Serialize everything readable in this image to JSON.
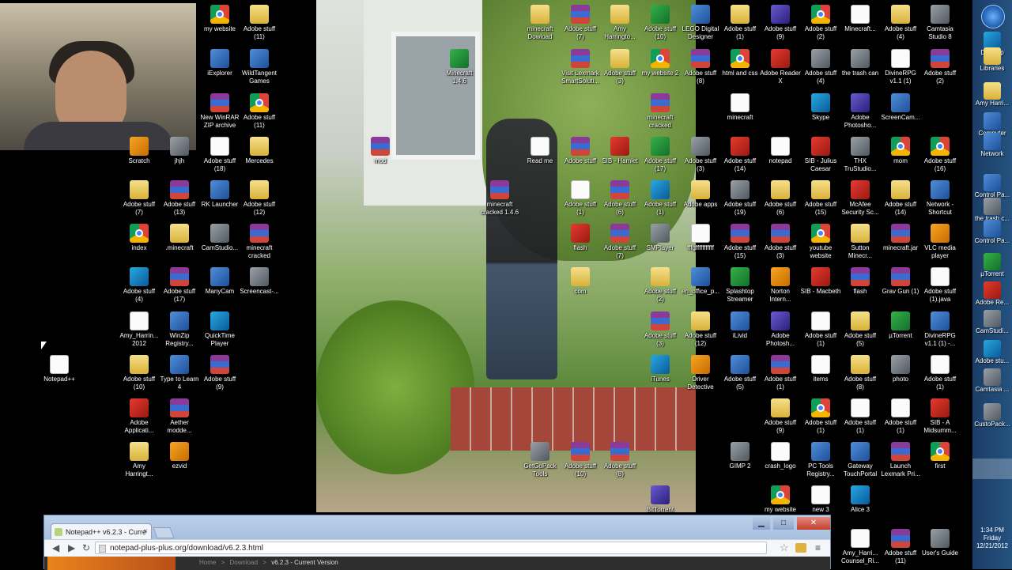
{
  "desktop": {
    "icons_left": [
      {
        "label": "my website",
        "type": "chrome"
      },
      {
        "label": "Adobe stuff (11)",
        "type": "folder"
      },
      {
        "label": "iExplorer",
        "type": "app"
      },
      {
        "label": "WildTangent Games",
        "type": "app"
      },
      {
        "label": "New WinRAR ZIP archive",
        "type": "rar"
      },
      {
        "label": "Adobe stuff (11)",
        "type": "chrome"
      },
      {
        "label": "Scratch",
        "type": "orange"
      },
      {
        "label": "jhjh",
        "type": "gray"
      },
      {
        "label": "Adobe stuff (18)",
        "type": "doc"
      },
      {
        "label": "Mercedes",
        "type": "folder"
      },
      {
        "label": "Adobe stuff (7)",
        "type": "folder"
      },
      {
        "label": "Adobe stuff (13)",
        "type": "rar"
      },
      {
        "label": "RK Launcher",
        "type": "app"
      },
      {
        "label": "Adobe stuff (12)",
        "type": "folder"
      },
      {
        "label": "index",
        "type": "chrome"
      },
      {
        "label": ".minecraft",
        "type": "folder"
      },
      {
        "label": "CamStudio...",
        "type": "gray"
      },
      {
        "label": "minecraft cracked",
        "type": "rar"
      },
      {
        "label": "Adobe stuff (4)",
        "type": "blue"
      },
      {
        "label": "Adobe stuff (17)",
        "type": "rar"
      },
      {
        "label": "ManyCam",
        "type": "app"
      },
      {
        "label": "Screencast-...",
        "type": "gray"
      },
      {
        "label": "Amy_Harrin... 2012",
        "type": "doc"
      },
      {
        "label": "WinZip Registry...",
        "type": "app"
      },
      {
        "label": "QuickTime Player",
        "type": "blue"
      },
      {
        "label": "Notepad++",
        "type": "doc"
      },
      {
        "label": "Adobe stuff (10)",
        "type": "folder"
      },
      {
        "label": "Type to Learn 4",
        "type": "app"
      },
      {
        "label": "Adobe stuff (9)",
        "type": "rar"
      },
      {
        "label": "Adobe Applicati...",
        "type": "red"
      },
      {
        "label": "Aether modde...",
        "type": "rar"
      },
      {
        "label": "Amy Harringt...",
        "type": "folder"
      },
      {
        "label": "ezvid",
        "type": "orange"
      }
    ],
    "icons_middle": [
      {
        "label": "minecraft Dowload",
        "type": "folder"
      },
      {
        "label": "Adobe stuff (7)",
        "type": "rar"
      },
      {
        "label": "Amy Harringto...",
        "type": "folder"
      },
      {
        "label": "Adobe stuff (10)",
        "type": "green"
      },
      {
        "label": "Minecraft 1.4.6",
        "type": "green"
      },
      {
        "label": "Visit Lexmark SmartSoluti...",
        "type": "rar"
      },
      {
        "label": "Adobe stuff (3)",
        "type": "folder"
      },
      {
        "label": "my website 2",
        "type": "chrome"
      },
      {
        "label": "minecraft cracked",
        "type": "rar"
      },
      {
        "label": "mod",
        "type": "rar"
      },
      {
        "label": "Read me",
        "type": "doc"
      },
      {
        "label": "Adobe stuff",
        "type": "rar"
      },
      {
        "label": "SIB - Hamlet",
        "type": "red"
      },
      {
        "label": "Adobe stuff (17)",
        "type": "green"
      },
      {
        "label": "minecraft cracked 1.4.6",
        "type": "rar"
      },
      {
        "label": "Adobe stuff (1)",
        "type": "doc"
      },
      {
        "label": "Adobe stuff (6)",
        "type": "rar"
      },
      {
        "label": "Adobe stuff (1)",
        "type": "blue"
      },
      {
        "label": "flash",
        "type": "red"
      },
      {
        "label": "Adobe stuff (7)",
        "type": "rar"
      },
      {
        "label": "SMPlayer",
        "type": "gray"
      },
      {
        "label": "com",
        "type": "folder"
      },
      {
        "label": "Adobe stuff (2)",
        "type": "folder"
      },
      {
        "label": "Adobe stuff (3)",
        "type": "rar"
      },
      {
        "label": "iTunes",
        "type": "blue"
      },
      {
        "label": "GetGoPack Tools",
        "type": "gray"
      },
      {
        "label": "Adobe stuff (10)",
        "type": "rar"
      },
      {
        "label": "Adobe stuff (8)",
        "type": "rar"
      },
      {
        "label": "BitTorrent",
        "type": "purple"
      }
    ],
    "icons_right": [
      {
        "label": "LEGO Digital Designer",
        "type": "app"
      },
      {
        "label": "Adobe stuff (1)",
        "type": "folder"
      },
      {
        "label": "Adobe stuff (9)",
        "type": "purple"
      },
      {
        "label": "Adobe stuff (2)",
        "type": "chrome"
      },
      {
        "label": "Minecraft...",
        "type": "doc"
      },
      {
        "label": "Adobe stuff (4)",
        "type": "folder"
      },
      {
        "label": "Camtasia Studio 8",
        "type": "gray"
      },
      {
        "label": "Adobe stuff (8)",
        "type": "rar"
      },
      {
        "label": "html and css",
        "type": "chrome"
      },
      {
        "label": "Adobe Reader X",
        "type": "red"
      },
      {
        "label": "Adobe stuff (4)",
        "type": "gray"
      },
      {
        "label": "the trash can",
        "type": "gray"
      },
      {
        "label": "DivineRPG v1.1 (1)",
        "type": "doc"
      },
      {
        "label": "Adobe stuff (2)",
        "type": "rar"
      },
      {
        "label": "minecraft",
        "type": "doc"
      },
      {
        "label": "Skype",
        "type": "blue"
      },
      {
        "label": "Adobe Photosho...",
        "type": "purple"
      },
      {
        "label": "ScreenCam...",
        "type": "app"
      },
      {
        "label": "Adobe stuff (3)",
        "type": "gray"
      },
      {
        "label": "Adobe stuff (14)",
        "type": "red"
      },
      {
        "label": "notepad",
        "type": "doc"
      },
      {
        "label": "SIB - Julius Caesar",
        "type": "red"
      },
      {
        "label": "THX TruStudio...",
        "type": "gray"
      },
      {
        "label": "mom",
        "type": "chrome"
      },
      {
        "label": "Adobe stuff (16)",
        "type": "chrome"
      },
      {
        "label": "Adobe apps",
        "type": "folder"
      },
      {
        "label": "Adobe stuff (19)",
        "type": "gray"
      },
      {
        "label": "Adobe stuff (6)",
        "type": "folder"
      },
      {
        "label": "Adobe stuff (15)",
        "type": "folder"
      },
      {
        "label": "McAfee Security Sc...",
        "type": "red"
      },
      {
        "label": "Adobe stuff (14)",
        "type": "folder"
      },
      {
        "label": "Network - Shortcut",
        "type": "app"
      },
      {
        "label": "fffgfffffffffff",
        "type": "doc"
      },
      {
        "label": "Adobe stuff (15)",
        "type": "rar"
      },
      {
        "label": "Adobe stuff (3)",
        "type": "rar"
      },
      {
        "label": "youtube website",
        "type": "chrome"
      },
      {
        "label": "Sutton Minecr...",
        "type": "folder"
      },
      {
        "label": "minecraft.jar",
        "type": "rar"
      },
      {
        "label": "VLC media player",
        "type": "orange"
      },
      {
        "label": "en_office_p...",
        "type": "app"
      },
      {
        "label": "Splashtop Streamer",
        "type": "green"
      },
      {
        "label": "Norton Intern...",
        "type": "orange"
      },
      {
        "label": "SIB - Macbeth",
        "type": "red"
      },
      {
        "label": "flash",
        "type": "rar"
      },
      {
        "label": "Grav Gun (1)",
        "type": "rar"
      },
      {
        "label": "Adobe stuff (1).java",
        "type": "doc"
      },
      {
        "label": "Adobe stuff (12)",
        "type": "folder"
      },
      {
        "label": "iLivid",
        "type": "app"
      },
      {
        "label": "Adobe Photosh...",
        "type": "purple"
      },
      {
        "label": "Adobe stuff (1)",
        "type": "doc"
      },
      {
        "label": "Adobe stuff (5)",
        "type": "folder"
      },
      {
        "label": "µTorrent",
        "type": "green"
      },
      {
        "label": "DivineRPG v1.1 (1) -...",
        "type": "app"
      },
      {
        "label": "Driver Detective",
        "type": "orange"
      },
      {
        "label": "Adobe stuff (5)",
        "type": "app"
      },
      {
        "label": "Adobe stuff (1)",
        "type": "rar"
      },
      {
        "label": "items",
        "type": "doc"
      },
      {
        "label": "Adobe stuff (8)",
        "type": "folder"
      },
      {
        "label": "photo",
        "type": "gray"
      },
      {
        "label": "Adobe stuff (1)",
        "type": "doc"
      },
      {
        "label": "Adobe stuff (9)",
        "type": "folder"
      },
      {
        "label": "Adobe stuff (1)",
        "type": "chrome"
      },
      {
        "label": "Adobe stuff (1)",
        "type": "doc"
      },
      {
        "label": "Adobe stuff (1)",
        "type": "doc"
      },
      {
        "label": "SIB - A Midsumm...",
        "type": "red"
      },
      {
        "label": "GIMP 2",
        "type": "gray"
      },
      {
        "label": "crash_logo",
        "type": "doc"
      },
      {
        "label": "PC Tools Registry...",
        "type": "app"
      },
      {
        "label": "Gateway TouchPortal",
        "type": "app"
      },
      {
        "label": "Launch Lexmark Pri...",
        "type": "rar"
      },
      {
        "label": "first",
        "type": "chrome"
      },
      {
        "label": "my website",
        "type": "chrome"
      },
      {
        "label": "new 3",
        "type": "doc"
      },
      {
        "label": "Alice 3",
        "type": "blue"
      },
      {
        "label": "Amy_Harri... Counsel_Ri...",
        "type": "doc"
      },
      {
        "label": "Adobe stuff (11)",
        "type": "rar"
      },
      {
        "label": "User's Guide",
        "type": "gray"
      }
    ]
  },
  "sidebar": {
    "items": [
      {
        "label": "Desktop",
        "type": "blue"
      },
      {
        "label": "Libraries",
        "type": "folder"
      },
      {
        "label": "Amy Harri...",
        "type": "folder"
      },
      {
        "label": "Computer",
        "type": "app"
      },
      {
        "label": "Network",
        "type": "app"
      },
      {
        "label": "Control Pa...",
        "type": "app"
      },
      {
        "label": "the trash c...",
        "type": "gray"
      },
      {
        "label": "Control Pa...",
        "type": "app"
      },
      {
        "label": "µTorrent",
        "type": "green"
      },
      {
        "label": "Adobe Re...",
        "type": "red"
      },
      {
        "label": "CamStudi...",
        "type": "gray"
      },
      {
        "label": "Adobe stu...",
        "type": "blue"
      },
      {
        "label": "Camtasia ...",
        "type": "gray"
      },
      {
        "label": "CustoPack...",
        "type": "gray"
      }
    ],
    "clock": {
      "time": "1:34 PM",
      "day": "Friday",
      "date": "12/21/2012"
    }
  },
  "browser": {
    "tab_title": "Notepad++ v6.2.3 - Curre",
    "url": "notepad-plus-plus.org/download/v6.2.3.html",
    "breadcrumbs": [
      "Home",
      ">",
      "Download",
      ">",
      "v6.2.3 - Current Version"
    ],
    "window_buttons": {
      "minimize": "▁",
      "maximize": "□",
      "close": "✕"
    }
  }
}
